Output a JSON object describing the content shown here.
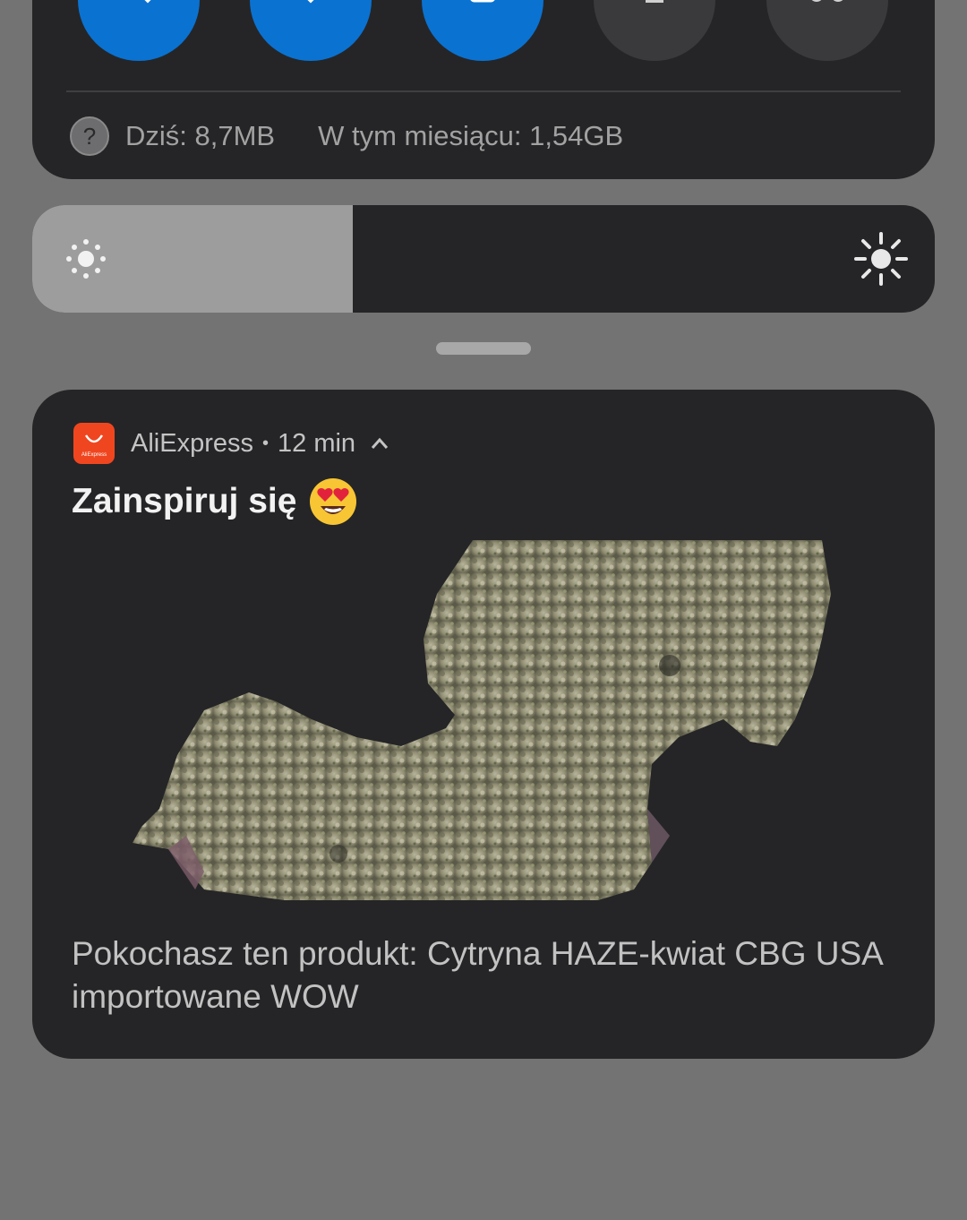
{
  "quick_settings": {
    "toggles": [
      {
        "icon": "mobile-data-icon",
        "state": "on"
      },
      {
        "icon": "wifi-icon",
        "state": "on"
      },
      {
        "icon": "portrait-lock-icon",
        "state": "on"
      },
      {
        "icon": "cast-icon",
        "state": "off"
      },
      {
        "icon": "link-icon",
        "state": "off"
      }
    ],
    "data_usage": {
      "help_glyph": "?",
      "today": "Dziś: 8,7MB",
      "month": "W tym miesiącu: 1,54GB"
    },
    "brightness_level": 0.355
  },
  "notification": {
    "app_name": "AliExpress",
    "app_icon_text": "AliExpress",
    "separator": "•",
    "time": "12 min",
    "title": "Zainspiruj się",
    "title_emoji": "heart-eyes-emoji",
    "image": "product-photo",
    "body": "Pokochasz ten produkt: Cytryna HAZE-kwiat CBG USA importowane WOW"
  },
  "colors": {
    "accent": "#0a72d1",
    "panel": "#252527",
    "shade_background": "#737373",
    "app_brand": "#f0461f"
  }
}
